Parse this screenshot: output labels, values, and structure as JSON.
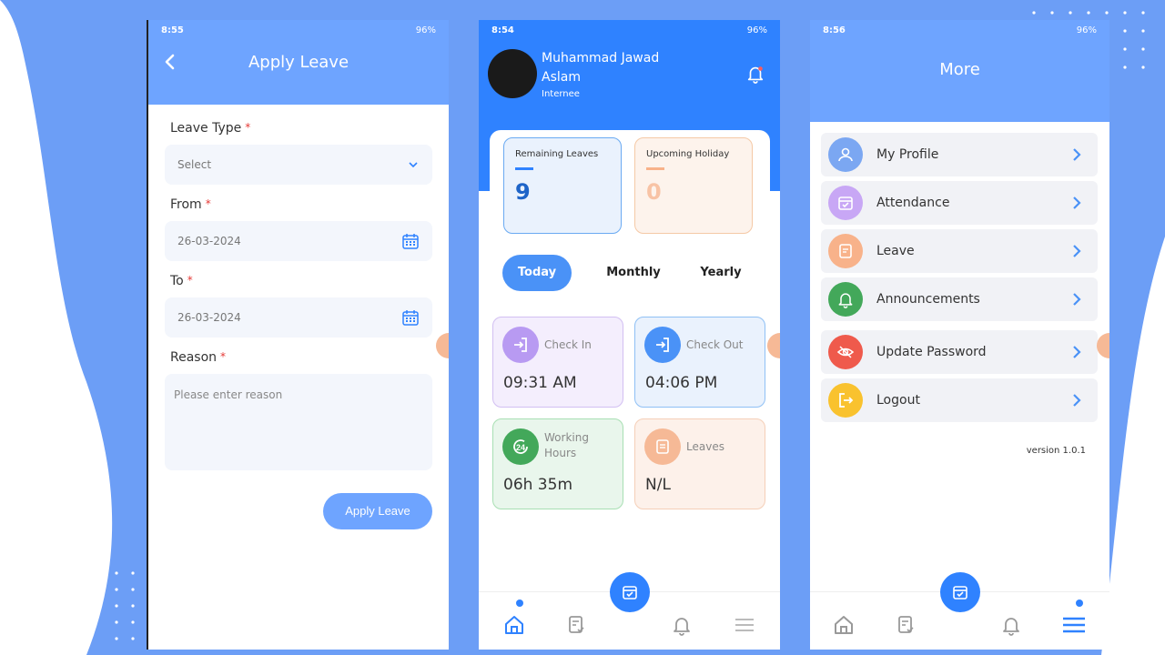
{
  "screen1": {
    "status_time": "8:55",
    "status_right": "96%",
    "title": "Apply Leave",
    "leave_type_label": "Leave Type",
    "leave_type_value": "Select",
    "from_label": "From",
    "from_value": "26-03-2024",
    "to_label": "To",
    "to_value": "26-03-2024",
    "reason_label": "Reason",
    "reason_placeholder": "Please enter reason",
    "required_mark": "*",
    "apply_button": "Apply Leave"
  },
  "screen2": {
    "status_time": "8:54",
    "status_right": "96%",
    "user_name": "Muhammad Jawad Aslam",
    "user_role": "Internee",
    "remaining_label": "Remaining Leaves",
    "remaining_value": "9",
    "holiday_label": "Upcoming Holiday",
    "holiday_value": "0",
    "tabs": [
      "Today",
      "Monthly",
      "Yearly"
    ],
    "tiles": [
      {
        "label": "Check In",
        "value": "09:31 AM"
      },
      {
        "label": "Check Out",
        "value": "04:06 PM"
      },
      {
        "label": "Working Hours",
        "value": "06h 35m"
      },
      {
        "label": "Leaves",
        "value": "N/L"
      }
    ]
  },
  "screen3": {
    "status_time": "8:56",
    "status_right": "96%",
    "title": "More",
    "menu": [
      {
        "label": "My Profile",
        "icon": "user-icon",
        "color": "#7ba7f2"
      },
      {
        "label": "Attendance",
        "icon": "calendar-check-icon",
        "color": "#c8a7f5"
      },
      {
        "label": "Leave",
        "icon": "document-icon",
        "color": "#f8b28a"
      },
      {
        "label": "Announcements",
        "icon": "bell-icon",
        "color": "#43a85a"
      },
      {
        "label": "Update Password",
        "icon": "eye-icon",
        "color": "#ef5a4c"
      },
      {
        "label": "Logout",
        "icon": "logout-icon",
        "color": "#f9c22e"
      }
    ],
    "version": "version 1.0.1"
  },
  "colors": {
    "primary": "#2f82ff",
    "header": "#6ea4ff",
    "background": "#6c9ef6"
  }
}
